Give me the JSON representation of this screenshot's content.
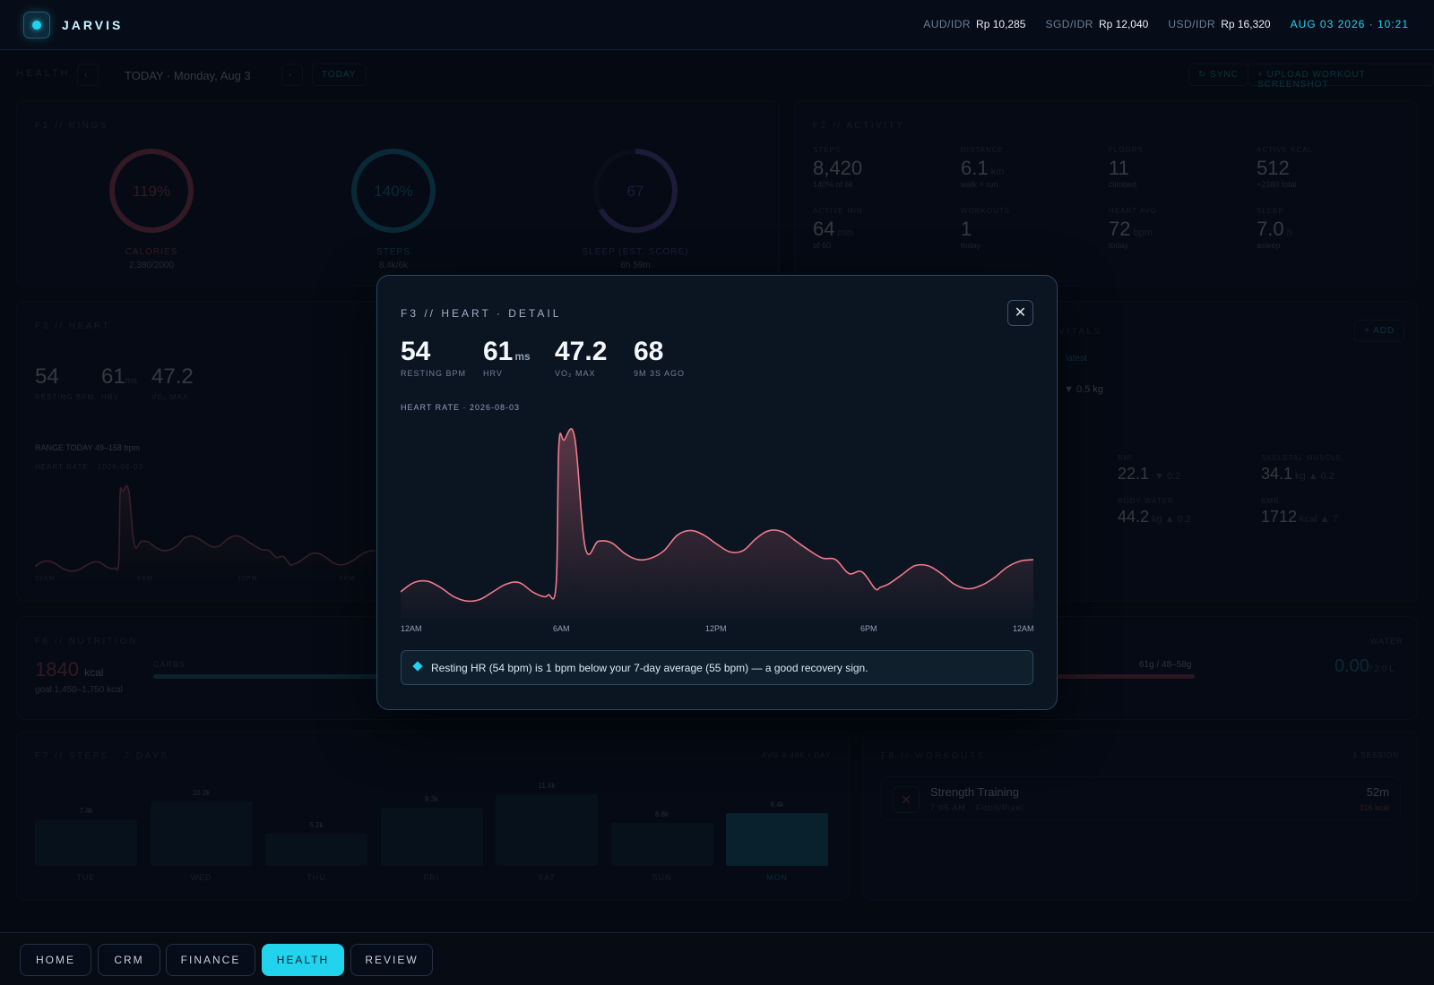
{
  "topbar": {
    "brand": "JARVIS",
    "rates": [
      {
        "label": "AUD/IDR",
        "value": "Rp 10,285"
      },
      {
        "label": "SGD/IDR",
        "value": "Rp 12,040"
      },
      {
        "label": "USD/IDR",
        "value": "Rp 16,320"
      }
    ],
    "clock": "AUG 03 2026 · 10:21"
  },
  "header": {
    "section": "HEALTH",
    "date": "TODAY · Monday, Aug 3",
    "today_btn": "TODAY",
    "sync_btn": "↻ SYNC",
    "upload_btn": "+ UPLOAD WORKOUT SCREENSHOT"
  },
  "rings": {
    "title": "F1 // RINGS",
    "items": [
      {
        "value": "119%",
        "label": "CALORIES",
        "sub": "2,380/2000",
        "pct": 1.19,
        "color": "#e05a6b"
      },
      {
        "value": "140%",
        "label": "STEPS",
        "sub": "8.4k/6k",
        "pct": 1.4,
        "color": "#22a8c8"
      },
      {
        "value": "67",
        "label": "SLEEP (EST. SCORE)",
        "sub": "6h 59m",
        "pct": 0.67,
        "color": "#7b63c9"
      }
    ]
  },
  "activity": {
    "title": "F2 // ACTIVITY",
    "items": [
      {
        "k": "STEPS",
        "v": "8,420",
        "unit": "",
        "s": "140% of 6k"
      },
      {
        "k": "DISTANCE",
        "v": "6.1",
        "unit": "km",
        "s": "walk + run"
      },
      {
        "k": "FLOORS",
        "v": "11",
        "unit": "",
        "s": "climbed"
      },
      {
        "k": "ACTIVE KCAL",
        "v": "512",
        "unit": "",
        "s": "+2380 total"
      },
      {
        "k": "ACTIVE MIN",
        "v": "64",
        "unit": "min",
        "s": "of 60"
      },
      {
        "k": "WORKOUTS",
        "v": "1",
        "unit": "",
        "s": "today"
      },
      {
        "k": "HEART AVG",
        "v": "72",
        "unit": "bpm",
        "s": "today"
      },
      {
        "k": "SLEEP",
        "v": "7.0",
        "unit": "h",
        "s": "asleep"
      }
    ]
  },
  "heart_panel": {
    "title": "F3 // HEART",
    "resting": "54",
    "resting_lbl": "RESTING BPM",
    "hrv": "61",
    "hrv_unit": "ms",
    "hrv_lbl": "HRV",
    "vo2": "47.2",
    "vo2_lbl": "VO₂ MAX",
    "range": "RANGE TODAY 49–158 bpm",
    "chart_lbl": "HEART RATE · 2026-08-03",
    "ticks": [
      "12AM",
      "6AM",
      "12PM",
      "6PM"
    ]
  },
  "vitals": {
    "title": "VITALS",
    "add_btn": "+ ADD",
    "latest": "latest",
    "delta": "▼ 0.5 kg",
    "items": [
      {
        "k": "BMI",
        "v": "22.1",
        "unit": "",
        "d": "▼ 0.2"
      },
      {
        "k": "SKELETAL MUSCLE",
        "v": "34.1",
        "unit": "kg",
        "d": "▲ 0.2"
      },
      {
        "k": "BODY WATER",
        "v": "44.2",
        "unit": "kg",
        "d": "▲ 0.2"
      },
      {
        "k": "BMR",
        "v": "1712",
        "unit": "kcal",
        "d": "▲ 7"
      }
    ]
  },
  "nutrition": {
    "title": "F6 // NUTRITION",
    "kcal": "1840",
    "kcal_unit": "kcal",
    "goal": "goal 1,450–1,750 kcal",
    "carbs_lbl": "CARBS",
    "fat_val": "61g / 48–58g",
    "water_lbl": "WATER",
    "water_val": "0.00",
    "water_goal": "/ 2.0 L"
  },
  "steps7": {
    "title": "F7 // STEPS · 7 DAYS",
    "avg": "AVG 8.40K / DAY",
    "days": [
      {
        "day": "TUE",
        "label": "7.4k",
        "value": 7.4
      },
      {
        "day": "WED",
        "label": "10.2k",
        "value": 10.2
      },
      {
        "day": "THU",
        "label": "5.2k",
        "value": 5.2
      },
      {
        "day": "FRI",
        "label": "9.3k",
        "value": 9.3
      },
      {
        "day": "SAT",
        "label": "11.4k",
        "value": 11.4
      },
      {
        "day": "SUN",
        "label": "6.8k",
        "value": 6.8
      },
      {
        "day": "MON",
        "label": "8.4k",
        "value": 8.4
      }
    ]
  },
  "workouts": {
    "title": "F8 // WORKOUTS",
    "count": "1 SESSION",
    "item": {
      "name": "Strength Training",
      "meta": "7:05 AM · Fitbit/Pixel",
      "duration": "52m",
      "kcal": "316 kcal"
    }
  },
  "nav": {
    "items": [
      "HOME",
      "CRM",
      "FINANCE",
      "HEALTH",
      "REVIEW"
    ],
    "active": "HEALTH"
  },
  "modal": {
    "title": "F3 // HEART · DETAIL",
    "stats": [
      {
        "v": "54",
        "unit": "",
        "k": "RESTING BPM"
      },
      {
        "v": "61",
        "unit": "ms",
        "k": "HRV"
      },
      {
        "v": "47.2",
        "unit": "",
        "k": "VO₂ MAX"
      },
      {
        "v": "68",
        "unit": "",
        "k": "9M 3S AGO"
      }
    ],
    "chart_label": "HEART RATE · 2026-08-03",
    "x_ticks": [
      "12AM",
      "6AM",
      "12PM",
      "6PM",
      "12AM"
    ],
    "insight": "Resting HR (54 bpm) is 1 bpm below your 7-day average (55 bpm) — a good recovery sign.",
    "close_icon": "close-icon",
    "accent": "#22d3ee",
    "line_color": "#f07a8a"
  },
  "chart_data": {
    "type": "line",
    "title": "HEART RATE · 2026-08-03",
    "xlabel": "",
    "ylabel": "",
    "x_ticks": [
      "12AM",
      "6AM",
      "12PM",
      "6PM",
      "12AM"
    ],
    "x_range": [
      0,
      24
    ],
    "ylim": [
      40,
      165
    ],
    "series": [
      {
        "x": [
          0,
          0.5,
          1,
          1.5,
          2,
          2.5,
          3,
          3.5,
          4,
          4.5,
          5,
          5.4,
          5.6,
          5.9,
          6,
          6.2,
          6.6,
          7,
          7.5,
          8,
          8.5,
          9,
          9.5,
          10,
          10.5,
          11,
          11.5,
          12,
          12.5,
          13,
          13.5,
          14,
          14.5,
          15,
          15.5,
          16,
          16.5,
          17,
          17.5,
          18,
          18.2,
          18.5,
          19,
          19.5,
          20,
          20.5,
          21,
          21.5,
          22,
          22.5,
          23,
          23.5,
          24
        ],
        "y": [
          57,
          63,
          64,
          60,
          54,
          51,
          52,
          57,
          62,
          63,
          57,
          54,
          55,
          62,
          152,
          156,
          158,
          86,
          90,
          89,
          82,
          78,
          79,
          84,
          94,
          97,
          94,
          88,
          83,
          84,
          92,
          97,
          96,
          90,
          84,
          79,
          78,
          69,
          70,
          59,
          60,
          62,
          68,
          74,
          74,
          69,
          62,
          59,
          61,
          66,
          73,
          77,
          78
        ]
      }
    ],
    "grid": false,
    "legend": "none"
  }
}
